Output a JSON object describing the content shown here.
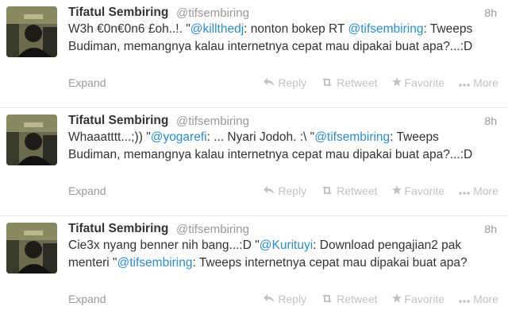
{
  "tweets": [
    {
      "fullname": "Tifatul Sembiring",
      "username": "@tifsembiring",
      "time": "8h",
      "parts": [
        {
          "t": "W3h €0n€0n6 £oh..!. \""
        },
        {
          "t": "@killthedj",
          "link": true
        },
        {
          "t": ": nonton bokep RT "
        },
        {
          "t": "@tifsembiring",
          "link": true
        },
        {
          "t": ": Tweeps Budiman, memangnya kalau internetnya cepat mau dipakai buat apa?...:D"
        }
      ],
      "expand": "Expand"
    },
    {
      "fullname": "Tifatul Sembiring",
      "username": "@tifsembiring",
      "time": "8h",
      "parts": [
        {
          "t": "Whaaatttt...;)) \""
        },
        {
          "t": "@yogarefi",
          "link": true
        },
        {
          "t": ": ... Nyari Jodoh. :\\ \""
        },
        {
          "t": "@tifsembiring",
          "link": true
        },
        {
          "t": ": Tweeps Budiman, memangnya kalau internetnya cepat mau dipakai buat apa?...:D"
        }
      ],
      "expand": "Expand"
    },
    {
      "fullname": "Tifatul Sembiring",
      "username": "@tifsembiring",
      "time": "8h",
      "parts": [
        {
          "t": "Cie3x nyang benner nih bang...:D \""
        },
        {
          "t": "@Kurituyi",
          "link": true
        },
        {
          "t": ": Download pengajian2 pak menteri \""
        },
        {
          "t": "@tifsembiring",
          "link": true
        },
        {
          "t": ": Tweeps internetnya cepat mau dipakai buat apa?"
        }
      ],
      "expand": "Expand"
    }
  ],
  "actions": {
    "reply": "Reply",
    "retweet": "Retweet",
    "favorite": "Favorite",
    "more": "More"
  },
  "icons": {
    "reply": "reply-icon",
    "retweet": "retweet-icon",
    "favorite": "star-icon",
    "more": "more-dots-icon"
  },
  "colors": {
    "link": "#2b8cd0",
    "muted": "#999999",
    "action": "#c3c3c3"
  }
}
